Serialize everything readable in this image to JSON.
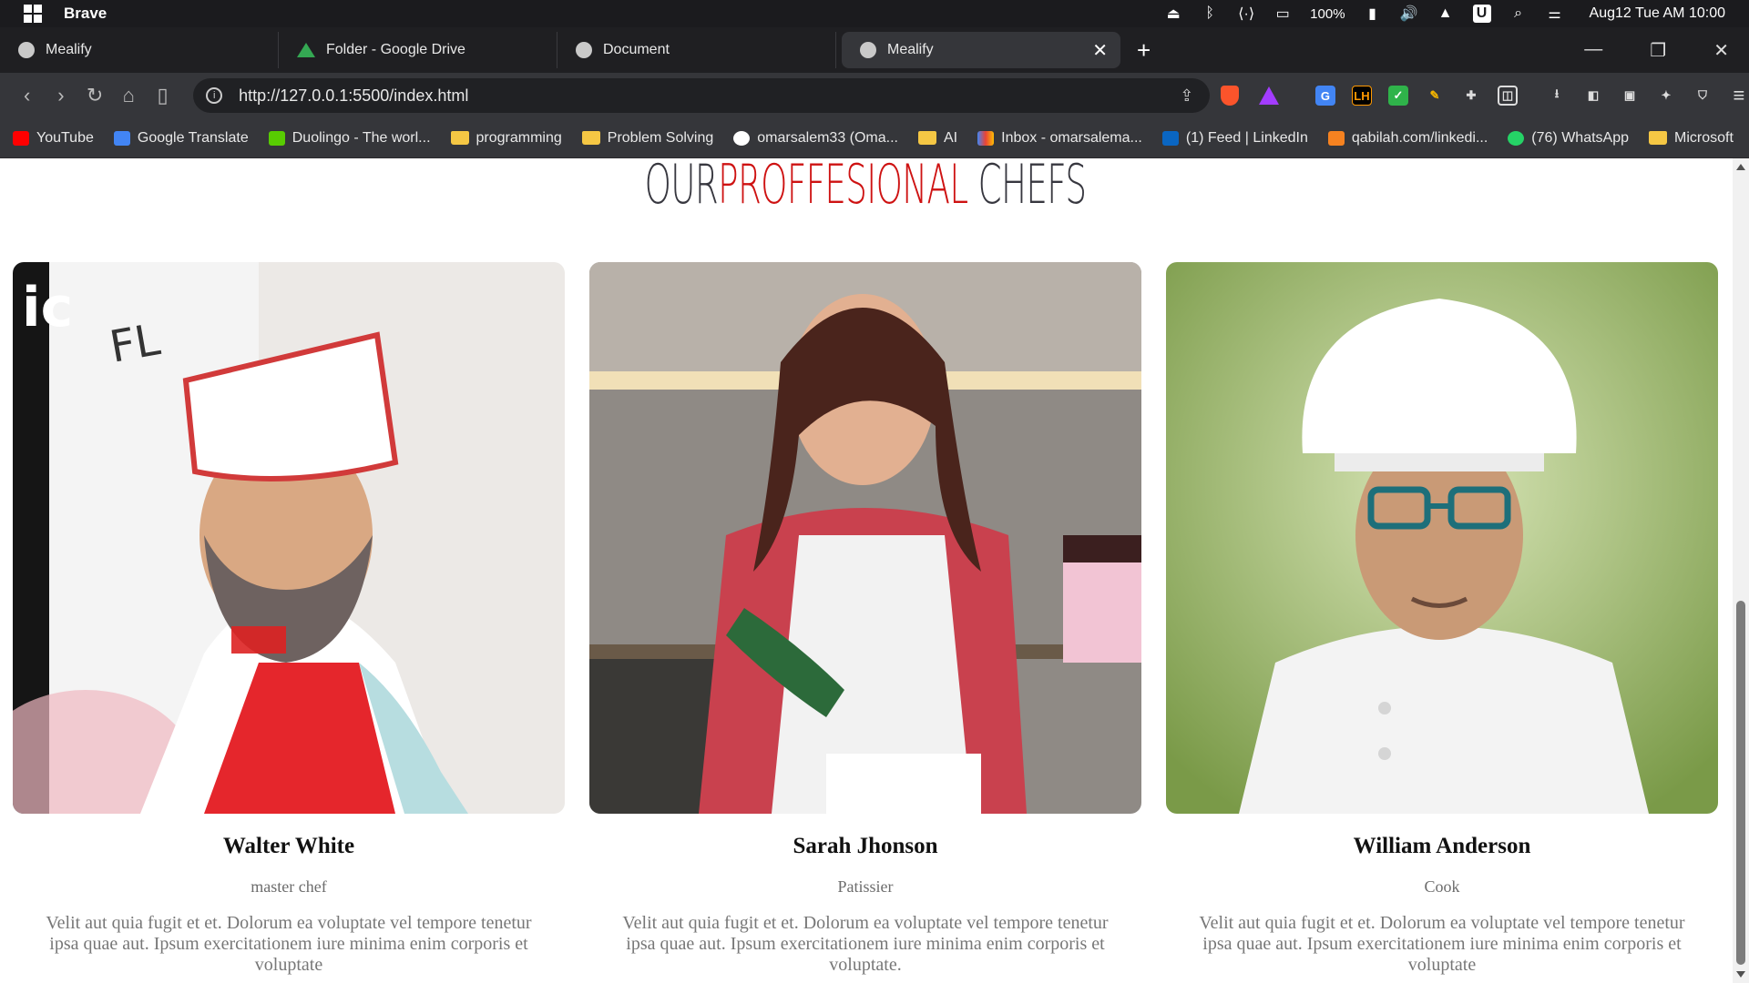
{
  "os": {
    "app_name": "Brave",
    "battery": "100%",
    "clock": "Aug12 Tue AM 10:00",
    "tray_icons": [
      "eject-icon",
      "bluetooth-icon",
      "network-icon",
      "display-icon",
      "battery-icon",
      "volume-icon",
      "wifi-icon",
      "u-icon",
      "search-icon",
      "toggle-icon"
    ]
  },
  "tabs": [
    {
      "title": "Mealify",
      "icon": "globe-icon"
    },
    {
      "title": "Folder - Google Drive",
      "icon": "google-drive-icon"
    },
    {
      "title": "Document",
      "icon": "globe-icon"
    },
    {
      "title": "Mealify",
      "icon": "globe-icon",
      "active": true
    }
  ],
  "toolbar": {
    "url": "http://127.0.0.1:5500/index.html"
  },
  "bookmarks": [
    {
      "label": "YouTube",
      "color": "#ff0000"
    },
    {
      "label": "Google Translate",
      "color": "#4285f4"
    },
    {
      "label": "Duolingo - The worl...",
      "color": "#58cc02"
    },
    {
      "label": "programming",
      "color": "folder"
    },
    {
      "label": "Problem Solving",
      "color": "folder"
    },
    {
      "label": "omarsalem33 (Oma...",
      "color": "#ffffff"
    },
    {
      "label": "AI",
      "color": "folder"
    },
    {
      "label": "Inbox - omarsalema...",
      "color": "#ea4335"
    },
    {
      "label": "(1) Feed | LinkedIn",
      "color": "#0a66c2"
    },
    {
      "label": "qabilah.com/linkedi...",
      "color": "#f58220"
    },
    {
      "label": "(76) WhatsApp",
      "color": "#25d366"
    },
    {
      "label": "Microsoft",
      "color": "folder"
    }
  ],
  "page": {
    "heading_our": "OUR",
    "heading_accent": "PROFFESIONAL",
    "heading_rest": " CHEFS",
    "accent_color": "#ce1212",
    "chefs": [
      {
        "name": "Walter White",
        "role": "master chef",
        "bio": "Velit aut quia fugit et et. Dolorum ea voluptate vel tempore tenetur ipsa quae aut. Ipsum exercitationem iure minima enim corporis et voluptate"
      },
      {
        "name": "Sarah Jhonson",
        "role": "Patissier",
        "bio": "Velit aut quia fugit et et. Dolorum ea voluptate vel tempore tenetur ipsa quae aut. Ipsum exercitationem iure minima enim corporis et voluptate."
      },
      {
        "name": "William Anderson",
        "role": "Cook",
        "bio": "Velit aut quia fugit et et. Dolorum ea voluptate vel tempore tenetur ipsa quae aut. Ipsum exercitationem iure minima enim corporis et voluptate"
      }
    ]
  }
}
